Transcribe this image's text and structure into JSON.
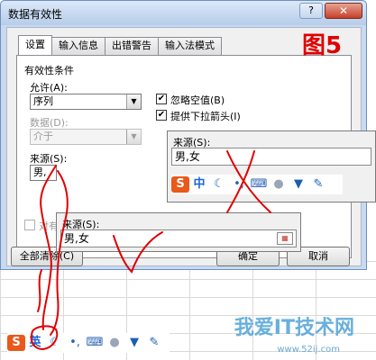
{
  "dialog": {
    "title": "数据有效性",
    "help_label": "?",
    "close_label": "✕",
    "tabs": [
      "设置",
      "输入信息",
      "出错警告",
      "输入法模式"
    ],
    "section_title": "有效性条件",
    "allow_label": "允许(A):",
    "allow_value": "序列",
    "data_label": "数据(D):",
    "data_value": "介于",
    "ignore_blank_label": "忽略空值(B)",
    "dropdown_label": "提供下拉箭头(I)",
    "source_label": "来源(S):",
    "source_value": "男,",
    "apply_all_partial": "对有",
    "clear_all_label": "全部清除(C)",
    "ok_label": "确定",
    "cancel_label": "取消"
  },
  "annotation": {
    "figure_label": "图5",
    "color": "#e00000"
  },
  "popup_top": {
    "label": "来源(S):",
    "value": "男,女"
  },
  "popup_bottom": {
    "label": "来源(S):",
    "value": "男,女"
  },
  "ime_top": {
    "logo": "S",
    "mode": "中"
  },
  "ime_bottom": {
    "logo": "S",
    "mode": "英"
  },
  "watermark": {
    "text": "我爱IT技术网",
    "url": "www.52ij.com"
  }
}
